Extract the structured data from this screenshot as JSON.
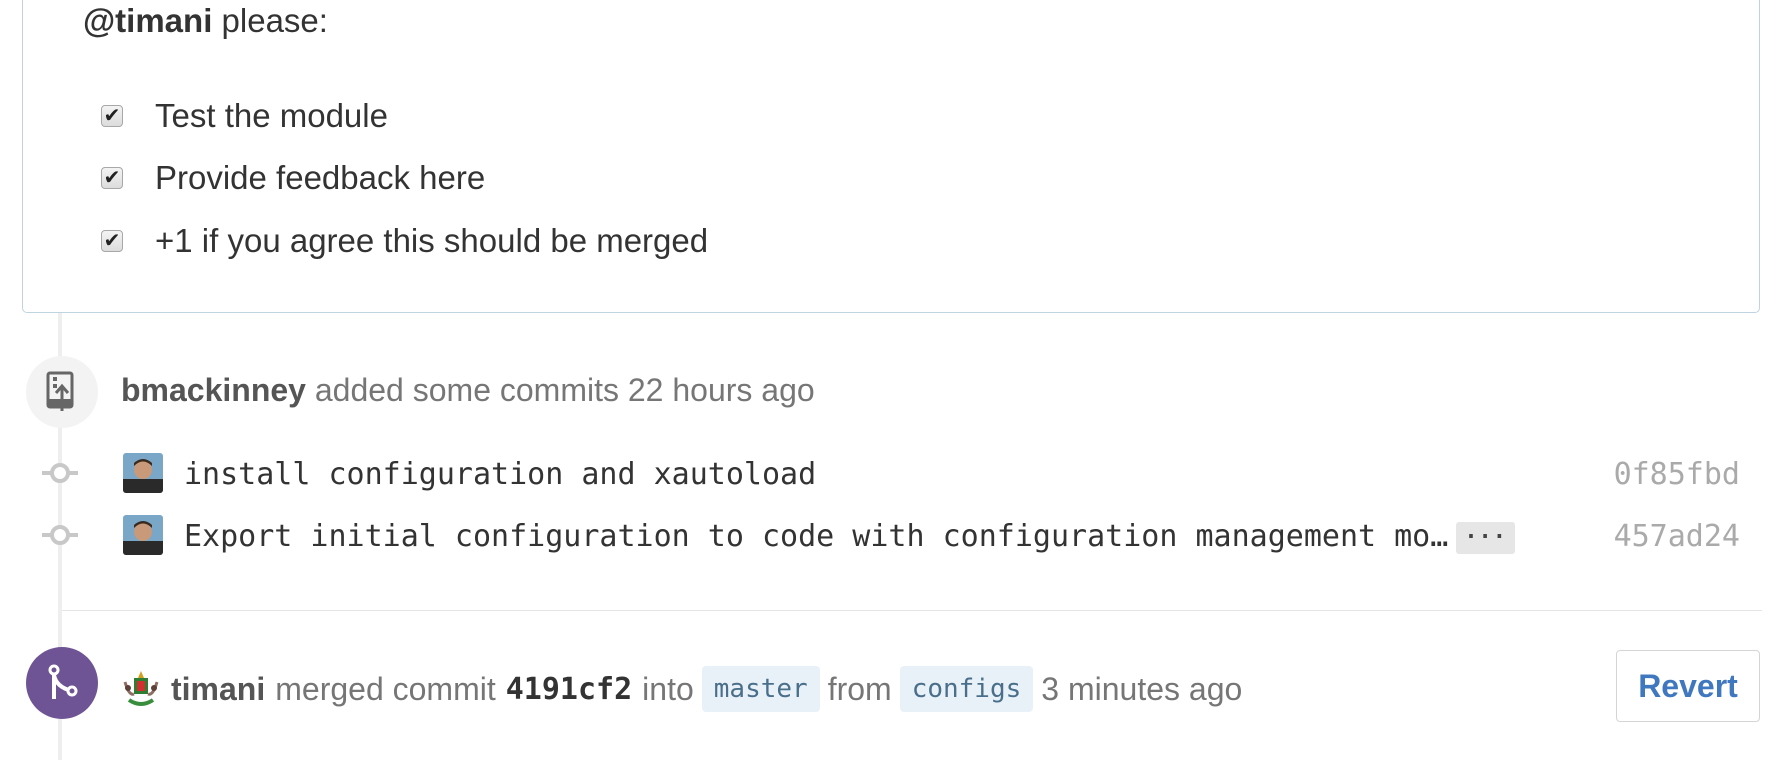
{
  "comment": {
    "mention": "@timani",
    "mention_suffix": " please:",
    "tasks": [
      {
        "label": "Test the module",
        "checked": true
      },
      {
        "label": "Provide feedback here",
        "checked": true
      },
      {
        "label": "+1 if you agree this should be merged",
        "checked": true
      }
    ]
  },
  "commits_event": {
    "author": "bmackinney",
    "action": " added some commits 22 hours ago",
    "icon": "repo-push-icon",
    "commits": [
      {
        "message": "install configuration and xautoload",
        "sha": "0f85fbd",
        "has_more": false
      },
      {
        "message": "Export initial configuration to code with configuration management mo…",
        "sha": "457ad24",
        "has_more": true,
        "more_label": "···"
      }
    ]
  },
  "merge_event": {
    "icon": "git-merge-icon",
    "author": "timani",
    "text_merged": "merged commit",
    "sha": "4191cf2",
    "text_into": "into",
    "base_branch": "master",
    "text_from": "from",
    "head_branch": "configs",
    "time": "3 minutes ago",
    "revert_label": "Revert",
    "badge_color": "#6e5494"
  }
}
